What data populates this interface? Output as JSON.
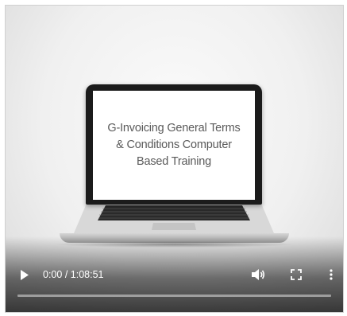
{
  "video": {
    "screen_title": "G-Invoicing General Terms\n& Conditions Computer\nBased Training",
    "progress": 0
  },
  "controls": {
    "current_time": "0:00",
    "separator": " / ",
    "duration": "1:08:51",
    "icons": [
      "play-icon",
      "volume-icon",
      "fullscreen-icon",
      "more-options-icon"
    ]
  }
}
